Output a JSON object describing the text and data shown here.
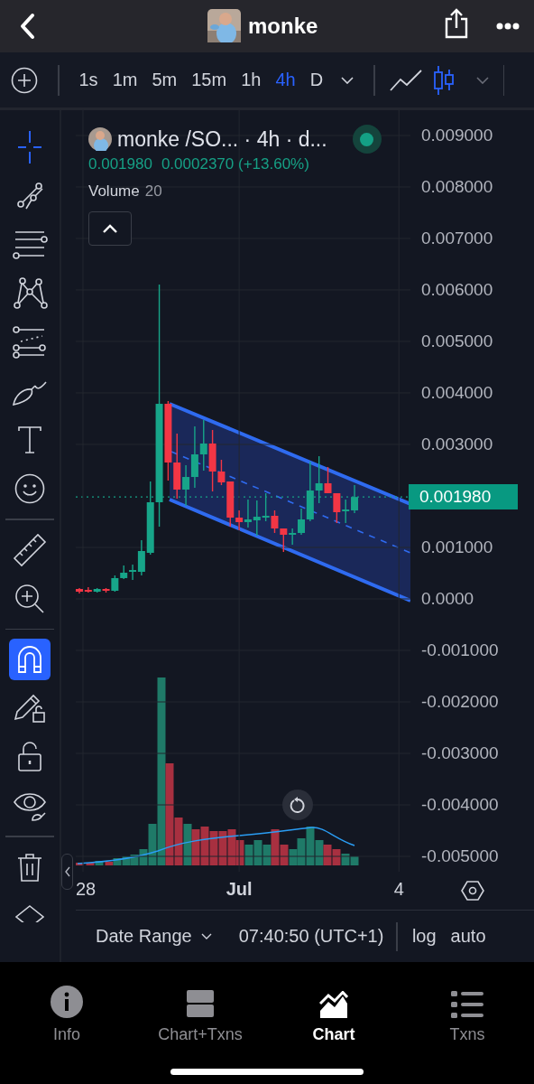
{
  "header": {
    "title": "monke"
  },
  "timeframes": [
    {
      "label": "1s",
      "selected": false
    },
    {
      "label": "1m",
      "selected": false
    },
    {
      "label": "5m",
      "selected": false
    },
    {
      "label": "15m",
      "selected": false
    },
    {
      "label": "1h",
      "selected": false
    },
    {
      "label": "4h",
      "selected": true
    },
    {
      "label": "D",
      "selected": false
    }
  ],
  "chart_types": [
    {
      "kind": "line",
      "selected": false
    },
    {
      "kind": "candles",
      "selected": true
    }
  ],
  "drawing_tools": [
    {
      "kind": "crosshair",
      "selected": true
    },
    {
      "kind": "trend-line",
      "selected": false
    },
    {
      "kind": "lines",
      "selected": false
    },
    {
      "kind": "pattern",
      "selected": false
    },
    {
      "kind": "channel",
      "selected": false
    },
    {
      "kind": "brush",
      "selected": false
    },
    {
      "kind": "text",
      "selected": false
    },
    {
      "kind": "emoji",
      "selected": false
    },
    {
      "kind": "divider"
    },
    {
      "kind": "ruler",
      "selected": false
    },
    {
      "kind": "zoom",
      "selected": false
    },
    {
      "kind": "divider"
    },
    {
      "kind": "magnet",
      "selected": true
    },
    {
      "kind": "pencil-lock",
      "selected": false
    },
    {
      "kind": "lock",
      "selected": false
    },
    {
      "kind": "eye",
      "selected": false
    },
    {
      "kind": "divider"
    },
    {
      "kind": "trash",
      "selected": false
    },
    {
      "kind": "layers",
      "selected": false
    }
  ],
  "legend": {
    "symbol": "monke /SO... · 4h · d...",
    "live": true,
    "price": "0.001980",
    "change": "0.0002370 (+13.60%)",
    "volume_label": "Volume",
    "volume_value": "20"
  },
  "chart": {
    "current_price": "0.001980",
    "chart_data": {
      "type": "candlestick",
      "categories": [
        "28",
        null,
        null,
        null,
        null,
        null,
        null,
        null,
        null,
        null,
        null,
        null,
        null,
        null,
        null,
        null,
        null,
        null,
        "Jul",
        null,
        null,
        null,
        null,
        null,
        null,
        null,
        null,
        null,
        null,
        null,
        null,
        null,
        null,
        null,
        null,
        null,
        "4"
      ],
      "ohlc": [
        [
          0.000193,
          0.000211,
          0.000105,
          0.00014
        ],
        [
          0.000175,
          0.000228,
          0.000123,
          0.00014
        ],
        [
          0.00014,
          0.000211,
          0.000123,
          0.000193
        ],
        [
          0.000193,
          0.000211,
          0.000123,
          0.000158
        ],
        [
          0.000158,
          0.000456,
          0.00014,
          0.000404
        ],
        [
          0.000404,
          0.000649,
          0.000386,
          0.000509
        ],
        [
          0.000526,
          0.000667,
          0.000368,
          0.000561
        ],
        [
          0.000526,
          0.00114,
          0.000456,
          0.00093
        ],
        [
          0.000895,
          0.002281,
          0.00086,
          0.001877
        ],
        [
          0.001877,
          0.006105,
          0.001404,
          0.003789
        ],
        [
          0.003789,
          0.003842,
          0.002298,
          0.002649
        ],
        [
          0.002649,
          0.003211,
          0.001947,
          0.002123
        ],
        [
          0.002123,
          0.002596,
          0.001807,
          0.002368
        ],
        [
          0.002368,
          0.003351,
          0.002158,
          0.002807
        ],
        [
          0.002807,
          0.003474,
          0.002491,
          0.003018
        ],
        [
          0.003018,
          0.003281,
          0.002088,
          0.002474
        ],
        [
          0.002474,
          0.002702,
          0.002211,
          0.002263
        ],
        [
          0.002281,
          0.002281,
          0.001404,
          0.001579
        ],
        [
          0.001579,
          0.001719,
          0.001333,
          0.001491
        ],
        [
          0.001491,
          0.00193,
          0.001386,
          0.001544
        ],
        [
          0.001526,
          0.001912,
          0.001228,
          0.001596
        ],
        [
          0.001579,
          0.002053,
          0.001509,
          0.001614
        ],
        [
          0.001614,
          0.001719,
          0.001281,
          0.001368
        ],
        [
          0.001368,
          0.001368,
          0.000912,
          0.001246
        ],
        [
          0.001246,
          0.001368,
          0.001053,
          0.001281
        ],
        [
          0.001281,
          0.001754,
          0.001246,
          0.001544
        ],
        [
          0.001544,
          0.002667,
          0.001509,
          0.002105
        ],
        [
          0.002105,
          0.002772,
          0.00186,
          0.002246
        ],
        [
          0.002246,
          0.002561,
          0.002053,
          0.002053
        ],
        [
          0.002053,
          0.002053,
          0.001474,
          0.001684
        ],
        [
          0.001702,
          0.00193,
          0.001474,
          0.001737
        ],
        [
          0.001719,
          0.002211,
          0.001667,
          0.00198
        ],
        null,
        null,
        null,
        null,
        null
      ],
      "ylim": [
        -0.005298,
        0.009491
      ],
      "grid": true,
      "yticks": [
        {
          "value": 0.009,
          "label": "0.009000"
        },
        {
          "value": 0.008,
          "label": "0.008000"
        },
        {
          "value": 0.007,
          "label": "0.007000"
        },
        {
          "value": 0.006,
          "label": "0.006000"
        },
        {
          "value": 0.005,
          "label": "0.005000"
        },
        {
          "value": 0.004,
          "label": "0.004000"
        },
        {
          "value": 0.003,
          "label": "0.003000"
        },
        {
          "value": 0.001,
          "label": "0.001000"
        },
        {
          "value": 0,
          "label": "0.0000"
        },
        {
          "value": -0.001,
          "label": "-0.001000"
        },
        {
          "value": -0.002,
          "label": "-0.002000"
        },
        {
          "value": -0.003,
          "label": "-0.003000"
        },
        {
          "value": -0.004,
          "label": "-0.004000"
        },
        {
          "value": -0.005,
          "label": "-0.005000"
        }
      ]
    }
  },
  "footer": {
    "date_range": "Date Range",
    "time": "07:40:50 (UTC+1)",
    "log": "log",
    "auto": "auto"
  },
  "tabs": [
    {
      "kind": "info",
      "label": "Info",
      "selected": false
    },
    {
      "kind": "split",
      "label": "Chart+Txns",
      "selected": false
    },
    {
      "kind": "chart",
      "label": "Chart",
      "selected": true
    },
    {
      "kind": "list",
      "label": "Txns",
      "selected": false
    }
  ]
}
